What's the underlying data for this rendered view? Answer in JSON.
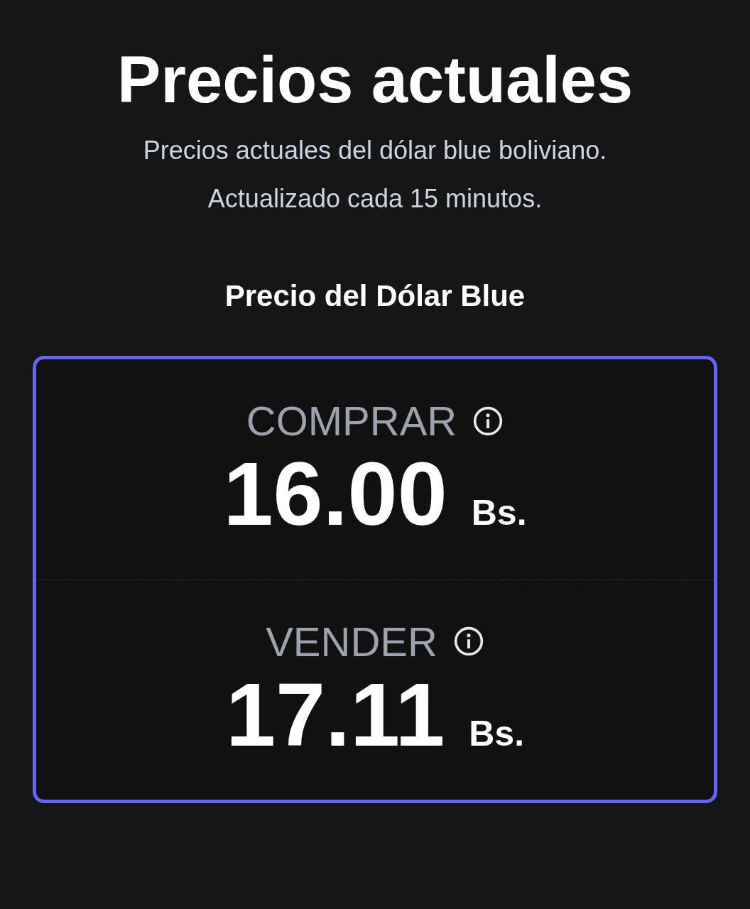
{
  "title": "Precios actuales",
  "subtitle": [
    "Precios actuales del dólar blue boliviano.",
    "Actualizado cada 15 minutos."
  ],
  "section_title": "Precio del Dólar Blue",
  "prices": [
    {
      "label": "COMPRAR",
      "value": "16.00",
      "currency": "Bs."
    },
    {
      "label": "VENDER",
      "value": "17.11",
      "currency": "Bs."
    }
  ]
}
